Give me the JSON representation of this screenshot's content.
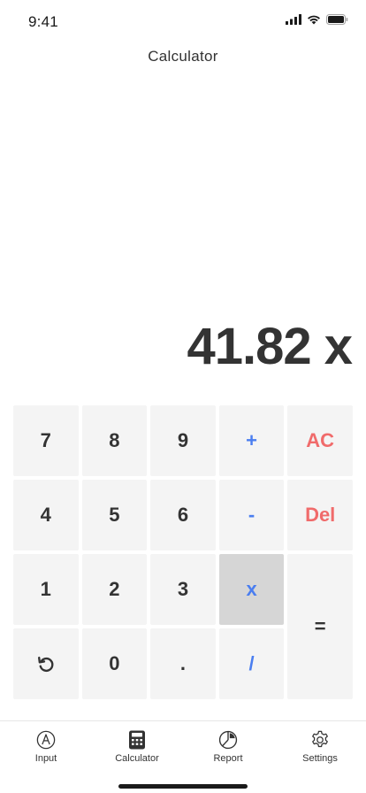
{
  "status": {
    "time": "9:41"
  },
  "header": {
    "title": "Calculator"
  },
  "display": {
    "value": "41.82 x"
  },
  "keypad": {
    "seven": "7",
    "eight": "8",
    "nine": "9",
    "plus": "+",
    "clear": "AC",
    "four": "4",
    "five": "5",
    "six": "6",
    "minus": "-",
    "delete": "Del",
    "one": "1",
    "two": "2",
    "three": "3",
    "multiply": "x",
    "equals": "=",
    "zero": "0",
    "decimal": ".",
    "divide": "/"
  },
  "tabs": [
    {
      "label": "Input",
      "icon": "pencil-circle-icon"
    },
    {
      "label": "Calculator",
      "icon": "calculator-icon"
    },
    {
      "label": "Report",
      "icon": "pie-chart-icon"
    },
    {
      "label": "Settings",
      "icon": "gear-icon"
    }
  ],
  "colors": {
    "operator": "#4a7ef0",
    "danger": "#f06b6b",
    "active_key": "#d6d6d6",
    "key_bg": "#f4f4f4"
  }
}
